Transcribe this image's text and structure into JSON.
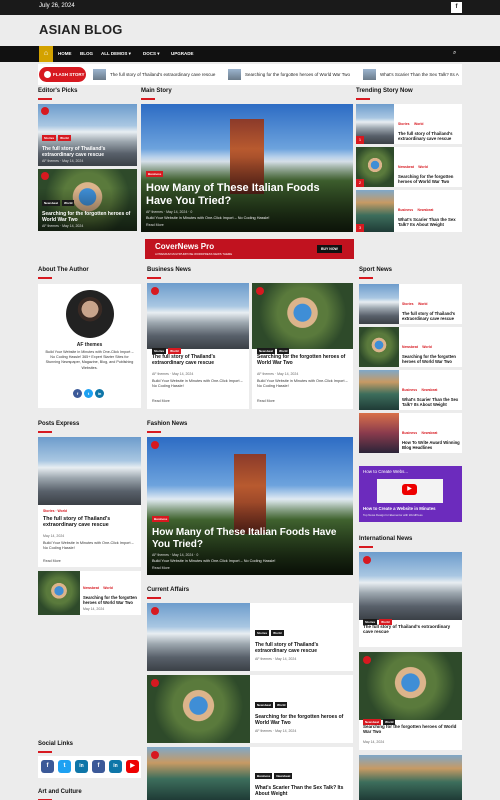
{
  "topbar": {
    "date": "July 26, 2024",
    "fb": "f"
  },
  "site": {
    "name": "ASIAN BLOG"
  },
  "nav": {
    "items": [
      "HOME",
      "BLOG",
      "ALL DEMOS ▾",
      "DOCS ▾",
      "UPGRADE"
    ]
  },
  "flash": {
    "label": "FLASH STORY",
    "items": [
      "The full story of Thailand's extraordinary cave rescue",
      "Searching for the forgotten heroes of World War Two",
      "What's Scarier Than the Sex Talk? Its A"
    ]
  },
  "sections": {
    "editors": "Editor's Picks",
    "main": "Main Story",
    "trending": "Trending Story Now",
    "about": "About The Author",
    "business": "Business News",
    "sport": "Sport News",
    "express": "Posts Express",
    "fashion": "Fashion News",
    "international": "International News",
    "affairs": "Current Affairs",
    "social": "Social Links",
    "art": "Art and Culture"
  },
  "tags": {
    "stories": "Stories",
    "world": "World",
    "newsbeat": "Newsbeat",
    "business": "Business"
  },
  "meta": {
    "author": "AF themes",
    "date": "May 14, 2024",
    "comments": "0"
  },
  "posts": {
    "thailand": "The full story of Thailand's extraordinary cave rescue",
    "heroes": "Searching for the forgotten heroes of World War Two",
    "italian": "How Many of These Italian Foods Have You Tried?",
    "scarier": "What's Scarier Than the Sex Talk? Its About Weight",
    "award": "How To Write Award Winning Blog Headlines",
    "excerpt": "Build Your Website in Minutes with One-Click Import – No Coding Hassle!",
    "read_more": "Read More"
  },
  "ad": {
    "title": "CoverNews Pro",
    "sub": "A PREMIUM MULTIPURPOSE WORDPRESS NEWS THEME",
    "btn": "BUY NOW"
  },
  "author": {
    "name": "AF themes",
    "bio": "Build Your Website in Minutes with One-Click Import – No Coding Hassle! 365+ Expert Starter Sites for Stunning Newspaper, Magazine, Blog, and Publishing Websites."
  },
  "video": {
    "title": "How to Create a Website in Minutes",
    "sub": "Top News Design for Elementor with WordPress",
    "head": "How to Create Webs..."
  },
  "trending_nums": [
    "1",
    "2",
    "3"
  ],
  "colors": {
    "accent": "#d71920",
    "dark": "#111111",
    "home": "#d3a200"
  }
}
